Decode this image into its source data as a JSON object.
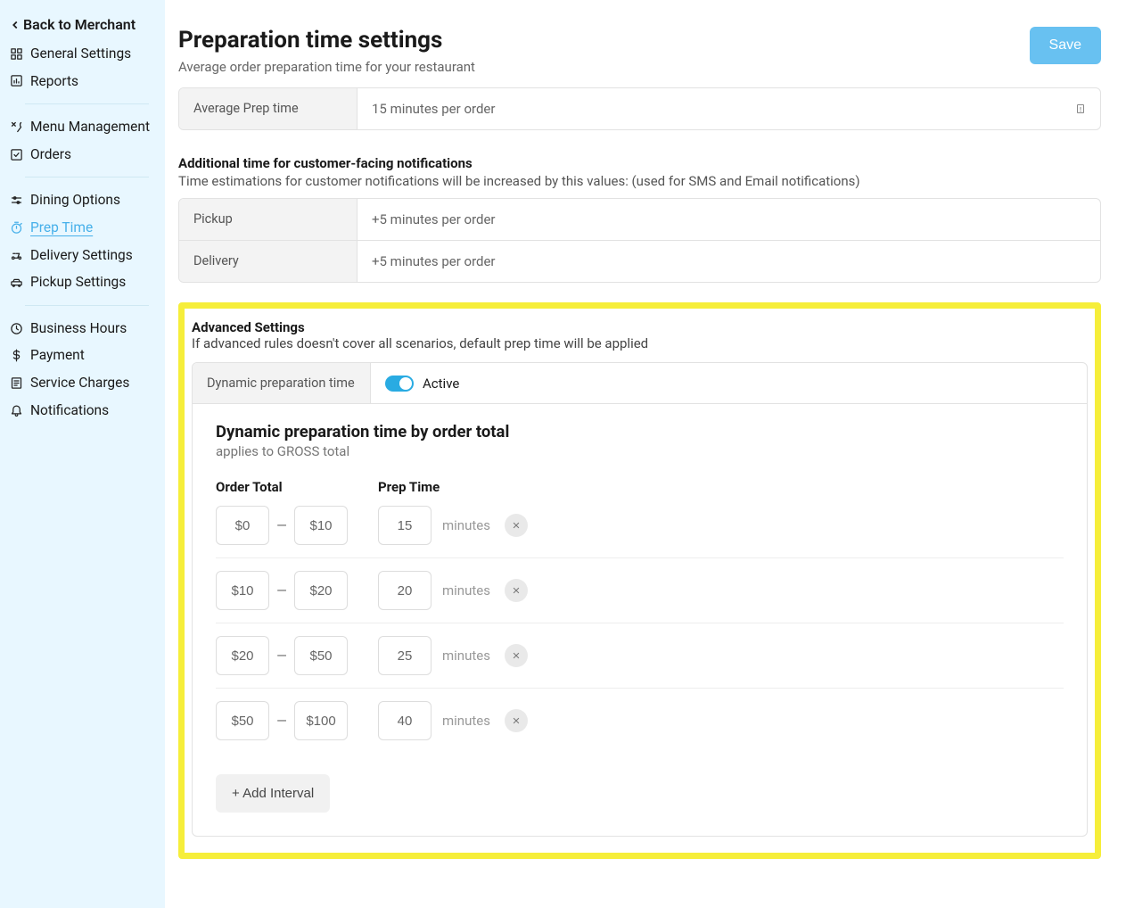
{
  "sidebar": {
    "back_label": "Back to Merchant",
    "items": [
      {
        "icon": "dashboard",
        "label": "General Settings"
      },
      {
        "icon": "chart",
        "label": "Reports"
      },
      {
        "divider": true
      },
      {
        "icon": "utensils",
        "label": "Menu Management"
      },
      {
        "icon": "check",
        "label": "Orders"
      },
      {
        "divider": true
      },
      {
        "icon": "sliders",
        "label": "Dining Options"
      },
      {
        "icon": "timer",
        "label": "Prep Time",
        "active": true
      },
      {
        "icon": "scooter",
        "label": "Delivery Settings"
      },
      {
        "icon": "car",
        "label": "Pickup Settings"
      },
      {
        "divider": true
      },
      {
        "icon": "clock",
        "label": "Business Hours"
      },
      {
        "icon": "dollar",
        "label": "Payment"
      },
      {
        "icon": "receipt",
        "label": "Service Charges"
      },
      {
        "icon": "bell",
        "label": "Notifications"
      }
    ]
  },
  "header": {
    "title": "Preparation time settings",
    "subtitle": "Average order preparation time for your restaurant",
    "save_label": "Save"
  },
  "avg_prep": {
    "label": "Average Prep time",
    "value": "15 minutes per order"
  },
  "additional": {
    "heading": "Additional time for customer-facing notifications",
    "sub": "Time estimations for customer notifications will be increased by this values: (used for SMS and Email notifications)",
    "rows": [
      {
        "label": "Pickup",
        "value": "+5 minutes per order"
      },
      {
        "label": "Delivery",
        "value": "+5 minutes per order"
      }
    ]
  },
  "advanced": {
    "heading": "Advanced Settings",
    "sub": "If advanced rules doesn't cover all scenarios, default prep time will be applied",
    "dyn_label": "Dynamic preparation time",
    "active_label": "Active",
    "body_title": "Dynamic preparation time by order total",
    "body_sub": "applies to GROSS total",
    "col_order": "Order Total",
    "col_prep": "Prep Time",
    "minutes_label": "minutes",
    "intervals": [
      {
        "from": "$0",
        "to": "$10",
        "prep": "15"
      },
      {
        "from": "$10",
        "to": "$20",
        "prep": "20"
      },
      {
        "from": "$20",
        "to": "$50",
        "prep": "25"
      },
      {
        "from": "$50",
        "to": "$100",
        "prep": "40"
      }
    ],
    "add_label": "+ Add Interval"
  },
  "chart_data": {
    "type": "table",
    "title": "Dynamic preparation time by order total",
    "columns": [
      "order_total_from_usd",
      "order_total_to_usd",
      "prep_time_minutes"
    ],
    "rows": [
      [
        0,
        10,
        15
      ],
      [
        10,
        20,
        20
      ],
      [
        20,
        50,
        25
      ],
      [
        50,
        100,
        40
      ]
    ]
  }
}
